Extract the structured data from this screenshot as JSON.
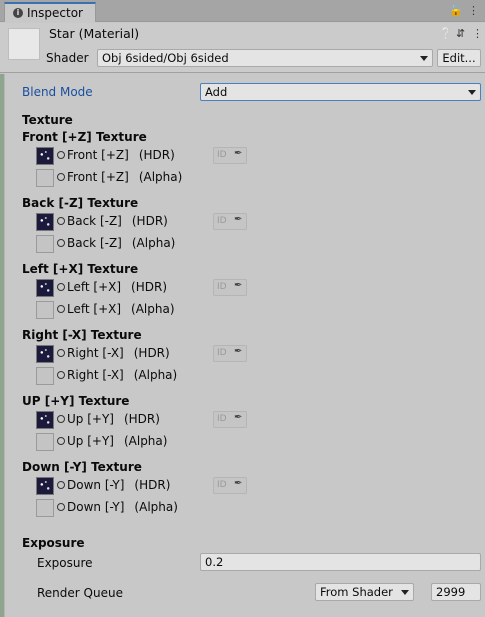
{
  "tab": {
    "icon": "info-icon",
    "label": "Inspector"
  },
  "material": {
    "name": "Star (Material)",
    "shader_label": "Shader",
    "shader_value": "Obj 6sided/Obj 6sided",
    "edit_label": "Edit..."
  },
  "blend": {
    "label": "Blend Mode",
    "value": "Add"
  },
  "texture_heading": "Texture",
  "groups": [
    {
      "title": "Front [+Z] Texture",
      "hdr_label": "Front [+Z]",
      "hdr_suffix": "(HDR)",
      "alpha_label": "Front [+Z]",
      "alpha_suffix": "(Alpha)"
    },
    {
      "title": "Back [-Z] Texture",
      "hdr_label": "Back [-Z]",
      "hdr_suffix": "(HDR)",
      "alpha_label": "Back [-Z]",
      "alpha_suffix": "(Alpha)"
    },
    {
      "title": "Left [+X] Texture",
      "hdr_label": "Left [+X]",
      "hdr_suffix": "(HDR)",
      "alpha_label": "Left [+X]",
      "alpha_suffix": "(Alpha)"
    },
    {
      "title": "Right [-X] Texture",
      "hdr_label": "Right [-X]",
      "hdr_suffix": "(HDR)",
      "alpha_label": "Right [-X]",
      "alpha_suffix": "(Alpha)"
    },
    {
      "title": "UP [+Y] Texture",
      "hdr_label": "Up [+Y]",
      "hdr_suffix": "(HDR)",
      "alpha_label": "Up [+Y]",
      "alpha_suffix": "(Alpha)"
    },
    {
      "title": "Down [-Y] Texture",
      "hdr_label": "Down [-Y]",
      "hdr_suffix": "(HDR)",
      "alpha_label": "Down [-Y]",
      "alpha_suffix": "(Alpha)"
    }
  ],
  "id_text": "ID",
  "exposure": {
    "heading": "Exposure",
    "label": "Exposure",
    "value": "0.2"
  },
  "render_queue": {
    "label": "Render Queue",
    "mode": "From Shader",
    "value": "2999"
  }
}
